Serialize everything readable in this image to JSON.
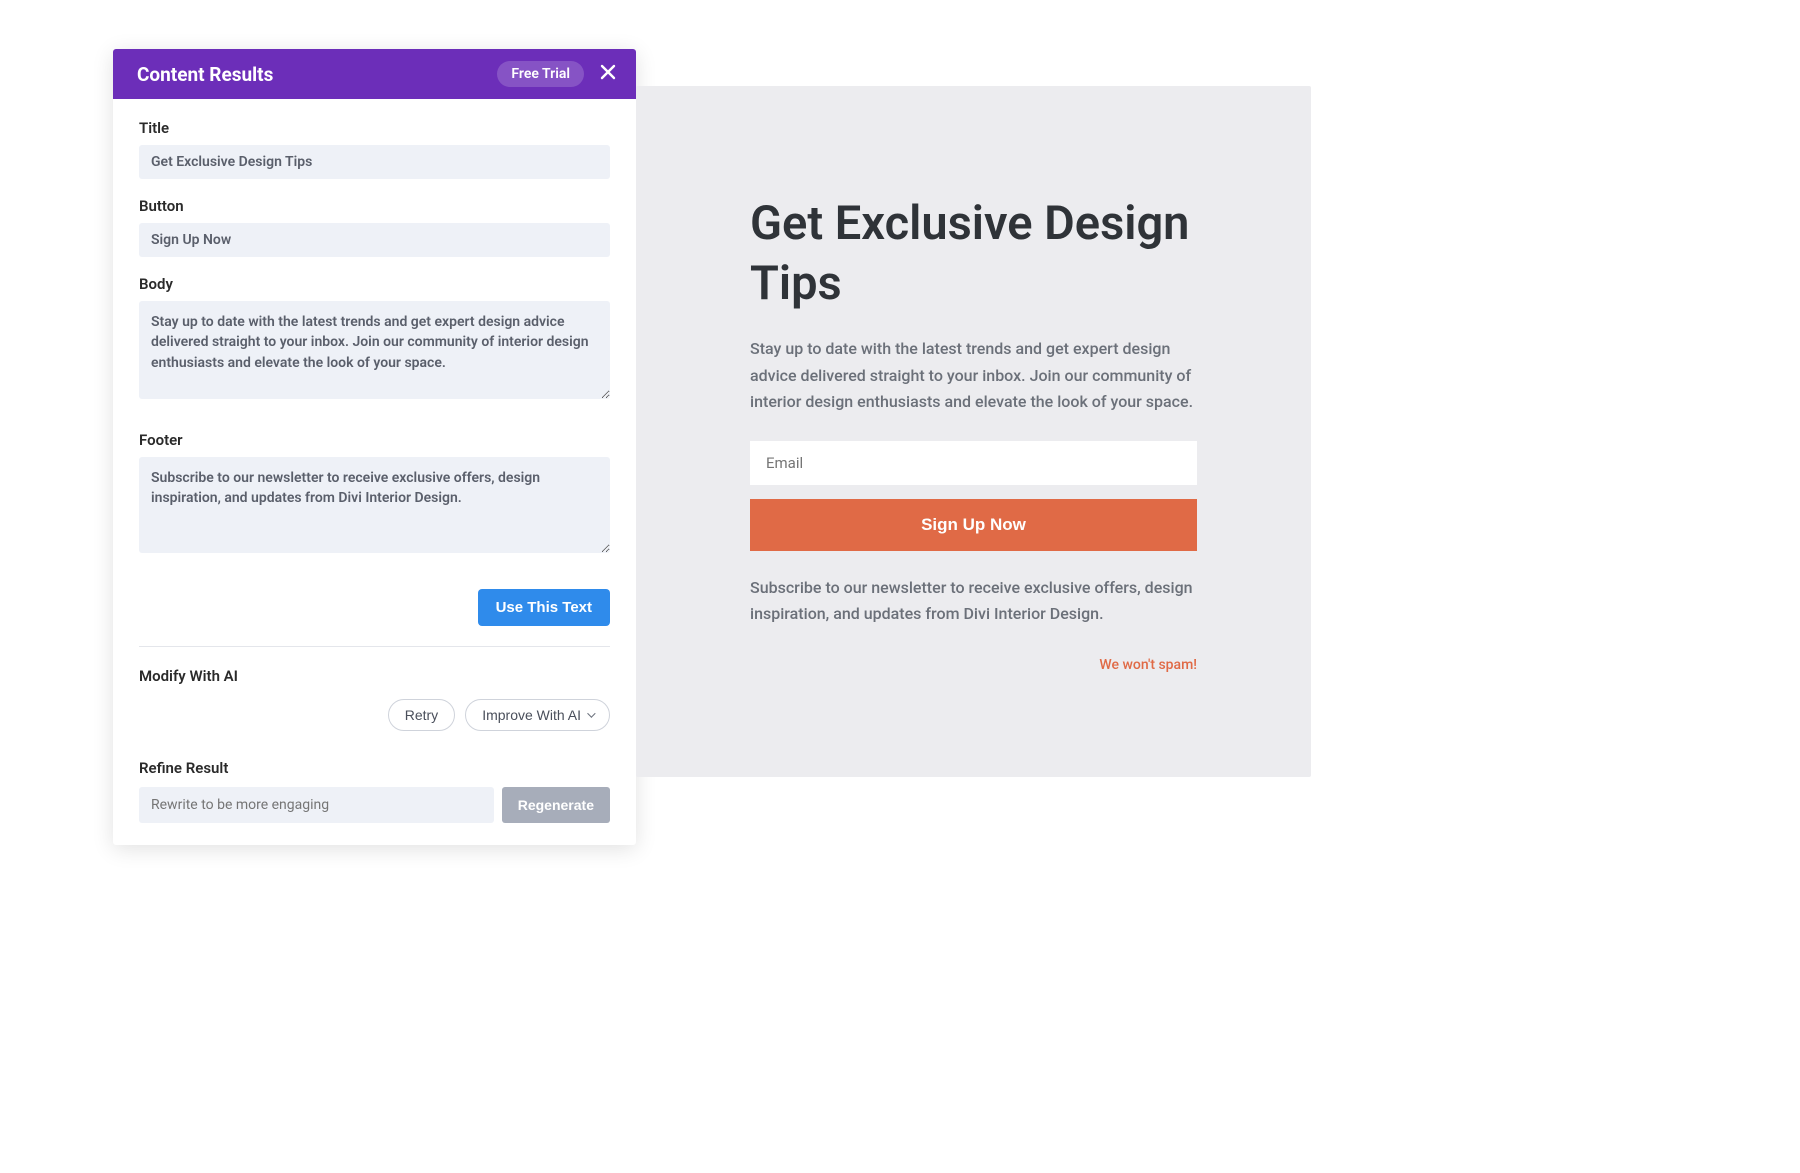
{
  "panel": {
    "title": "Content Results",
    "free_trial": "Free Trial",
    "fields": {
      "title_label": "Title",
      "title_value": "Get Exclusive Design Tips",
      "button_label": "Button",
      "button_value": "Sign Up Now",
      "body_label": "Body",
      "body_value": "Stay up to date with the latest trends and get expert design advice delivered straight to your inbox. Join our community of interior design enthusiasts and elevate the look of your space.",
      "footer_label": "Footer",
      "footer_value": "Subscribe to our newsletter to receive exclusive offers, design inspiration, and updates from Divi Interior Design."
    },
    "use_text": "Use This Text",
    "modify_label": "Modify With AI",
    "retry": "Retry",
    "improve": "Improve With AI",
    "refine_label": "Refine Result",
    "refine_placeholder": "Rewrite to be more engaging",
    "regenerate": "Regenerate"
  },
  "preview": {
    "heading": "Get Exclusive Design Tips",
    "body": "Stay up to date with the latest trends and get expert design advice delivered straight to your inbox. Join our community of interior design enthusiasts and elevate the look of your space.",
    "email_placeholder": "Email",
    "signup": "Sign Up Now",
    "footer": "Subscribe to our newsletter to receive exclusive offers, design inspiration, and updates from Divi Interior Design.",
    "spam": "We won't spam!"
  }
}
